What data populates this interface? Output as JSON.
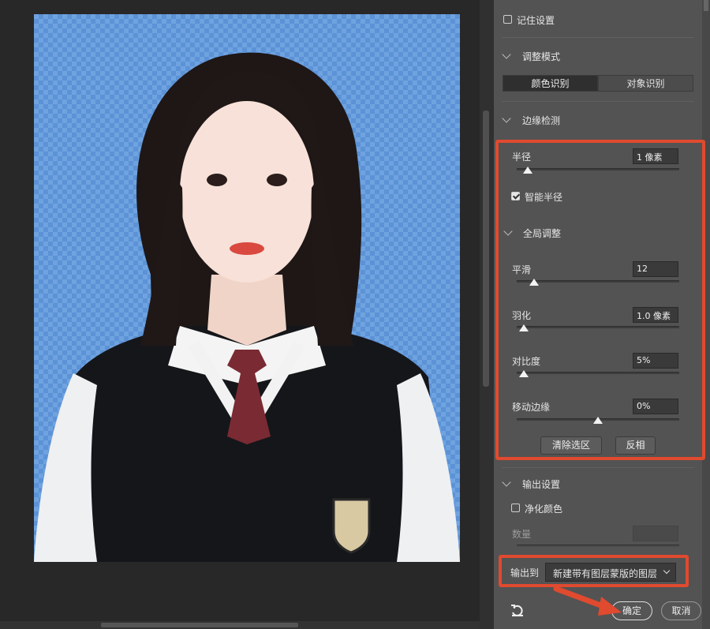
{
  "panel": {
    "remember_settings": {
      "label": "记住设置",
      "checked": false
    },
    "adjust_mode": {
      "title": "调整模式",
      "options": [
        "颜色识别",
        "对象识别"
      ],
      "selected": "颜色识别"
    },
    "edge_detection": {
      "title": "边缘检测",
      "radius": {
        "label": "半径",
        "value": "1 像素",
        "level": 0.07
      },
      "smart_radius": {
        "label": "智能半径",
        "checked": true
      }
    },
    "global_adjust": {
      "title": "全局调整",
      "smooth": {
        "label": "平滑",
        "value": "12",
        "level": 0.12
      },
      "feather": {
        "label": "羽化",
        "value": "1.0 像素",
        "level": 0.05
      },
      "contrast": {
        "label": "对比度",
        "value": "5%",
        "level": 0.05
      },
      "shift_edge": {
        "label": "移动边缘",
        "value": "0%",
        "level": 0.5
      },
      "clear_selection": "清除选区",
      "invert": "反相"
    },
    "output_settings": {
      "title": "输出设置",
      "decontaminate": {
        "label": "净化颜色",
        "checked": false
      },
      "amount": {
        "label": "数量",
        "value": ""
      },
      "output_to_label": "输出到",
      "output_to_value": "新建带有图层蒙版的图层"
    },
    "ok": "确定",
    "cancel": "取消"
  },
  "colors": {
    "panel_bg": "#535353",
    "canvas_bg": "#282828",
    "transparency_checker": "#6fa3e0",
    "highlight_red": "#e04a2f"
  },
  "icons": [
    "reset-icon",
    "chevron-down-icon",
    "dropdown-arrow-icon",
    "arrow-annotation"
  ]
}
